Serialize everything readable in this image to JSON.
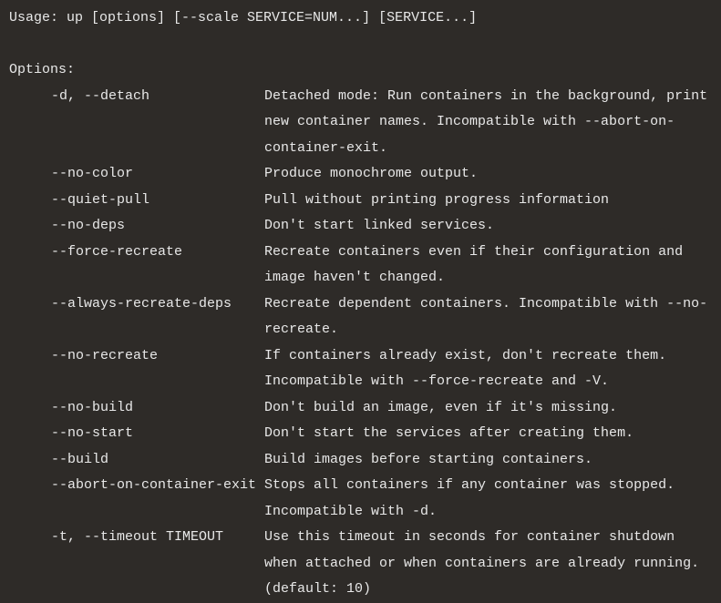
{
  "usage": "Usage: up [options] [--scale SERVICE=NUM...] [SERVICE...]",
  "options_header": "Options:",
  "options": [
    {
      "flag": "-d, --detach",
      "desc": "Detached mode: Run containers in the background, print new container names. Incompatible with --abort-on-container-exit."
    },
    {
      "flag": "--no-color",
      "desc": "Produce monochrome output."
    },
    {
      "flag": "--quiet-pull",
      "desc": "Pull without printing progress information"
    },
    {
      "flag": "--no-deps",
      "desc": "Don't start linked services."
    },
    {
      "flag": "--force-recreate",
      "desc": "Recreate containers even if their configuration and image haven't changed."
    },
    {
      "flag": "--always-recreate-deps",
      "desc": "Recreate dependent containers. Incompatible with --no-recreate."
    },
    {
      "flag": "--no-recreate",
      "desc": "If containers already exist, don't recreate them. Incompatible with --force-recreate and -V."
    },
    {
      "flag": "--no-build",
      "desc": "Don't build an image, even if it's missing."
    },
    {
      "flag": "--no-start",
      "desc": "Don't start the services after creating them."
    },
    {
      "flag": "--build",
      "desc": "Build images before starting containers."
    },
    {
      "flag": "--abort-on-container-exit",
      "desc": "Stops all containers if any container was stopped. Incompatible with -d."
    },
    {
      "flag": "-t, --timeout TIMEOUT",
      "desc": "Use this timeout in seconds for container shutdown when attached or when containers are already running. (default: 10)"
    }
  ]
}
